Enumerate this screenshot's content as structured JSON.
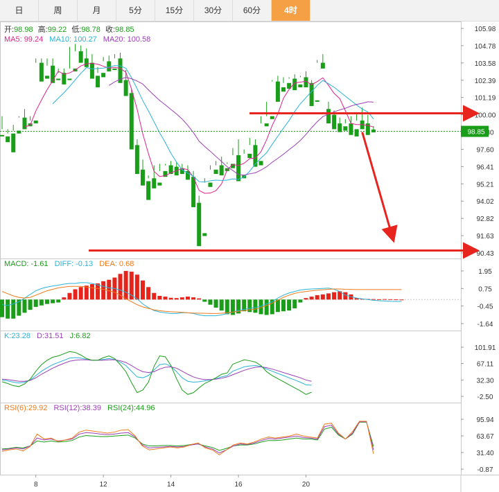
{
  "tabs": [
    {
      "label": "日",
      "active": false
    },
    {
      "label": "周",
      "active": false
    },
    {
      "label": "月",
      "active": false
    },
    {
      "label": "5分",
      "active": false
    },
    {
      "label": "15分",
      "active": false
    },
    {
      "label": "30分",
      "active": false
    },
    {
      "label": "60分",
      "active": false
    },
    {
      "label": "4时",
      "active": true
    }
  ],
  "info": {
    "open_label": "开:",
    "open": "98.98",
    "high_label": "高:",
    "high": "99.22",
    "low_label": "低:",
    "low": "98.78",
    "close_label": "收:",
    "close": "98.85",
    "ma5_label": "MA5:",
    "ma5": "99.24",
    "ma10_label": "MA10:",
    "ma10": "100.27",
    "ma20_label": "MA20:",
    "ma20": "100.58"
  },
  "macd_legend": {
    "macd_label": "MACD:",
    "macd": "-1.61",
    "diff_label": "DIFF:",
    "diff": "-0.13",
    "dea_label": "DEA:",
    "dea": "0.68"
  },
  "kdj_legend": {
    "k_label": "K:",
    "k": "23.28",
    "d_label": "D:",
    "d": "31.51",
    "j_label": "J:",
    "j": "6.82"
  },
  "rsi_legend": {
    "r6_label": "RSI(6):",
    "r6": "29.92",
    "r12_label": "RSI(12):",
    "r12": "38.39",
    "r24_label": "RSI(24):",
    "r24": "44.96"
  },
  "colors": {
    "up": "#e5251c",
    "down": "#1a9e1a",
    "ma5": "#e0208c",
    "ma10": "#2ab3d6",
    "ma20": "#9b3fb5",
    "arrow": "#e8241f",
    "current": "#1a9e1a",
    "macd_label": "#1a9e1a",
    "dea": "#f07a1a",
    "k": "#2ab3d6",
    "d": "#9b3fb5",
    "j": "#1a9e1a",
    "rsi6": "#f07a1a",
    "rsi12": "#9b3fb5",
    "rsi24": "#1a9e1a"
  },
  "current_price_label": "98.85",
  "chart_data": {
    "type": "candlestick",
    "x_tick_labels": [
      {
        "label": "8",
        "index": 6
      },
      {
        "label": "12",
        "index": 18
      },
      {
        "label": "14",
        "index": 30
      },
      {
        "label": "16",
        "index": 42
      },
      {
        "label": "20",
        "index": 54
      }
    ],
    "y_ticks": [
      "105.98",
      "104.78",
      "103.58",
      "102.39",
      "101.19",
      "100.00",
      "98.80",
      "97.60",
      "96.41",
      "95.21",
      "94.02",
      "92.82",
      "91.63",
      "90.43"
    ],
    "ylim": [
      90.43,
      105.98
    ],
    "candles": [
      [
        98.6,
        99.9,
        99.0,
        98.5
      ],
      [
        98.5,
        99.0,
        98.7,
        98.1
      ],
      [
        98.7,
        99.3,
        98.9,
        97.4
      ],
      [
        98.9,
        99.9,
        99.8,
        98.7
      ],
      [
        99.8,
        100.4,
        99.4,
        99.0
      ],
      [
        99.4,
        99.9,
        99.6,
        99.2
      ],
      [
        99.6,
        103.9,
        103.6,
        99.4
      ],
      [
        103.6,
        103.9,
        102.7,
        102.3
      ],
      [
        102.7,
        103.9,
        103.4,
        102.5
      ],
      [
        103.4,
        103.9,
        102.5,
        102.2
      ],
      [
        102.5,
        103.2,
        102.9,
        102.4
      ],
      [
        102.9,
        103.2,
        102.5,
        102.1
      ],
      [
        102.5,
        104.7,
        103.2,
        102.4
      ],
      [
        103.2,
        104.9,
        104.4,
        103.0
      ],
      [
        104.4,
        104.8,
        103.9,
        103.6
      ],
      [
        103.9,
        104.6,
        103.6,
        103.3
      ],
      [
        103.6,
        104.2,
        102.7,
        102.5
      ],
      [
        102.7,
        103.3,
        102.9,
        101.9
      ],
      [
        102.9,
        104.0,
        103.7,
        102.6
      ],
      [
        103.7,
        104.1,
        103.2,
        103.0
      ],
      [
        103.2,
        104.2,
        103.9,
        103.1
      ],
      [
        103.9,
        104.3,
        102.4,
        102.2
      ],
      [
        102.4,
        103.1,
        101.5,
        101.3
      ],
      [
        101.5,
        101.8,
        97.9,
        97.6
      ],
      [
        97.9,
        98.3,
        96.2,
        95.9
      ],
      [
        96.2,
        96.9,
        95.4,
        95.1
      ],
      [
        95.4,
        95.8,
        95.6,
        94.1
      ],
      [
        95.6,
        96.5,
        95.3,
        94.9
      ],
      [
        95.3,
        96.6,
        96.1,
        95.1
      ],
      [
        96.1,
        96.6,
        96.5,
        95.7
      ],
      [
        96.5,
        96.8,
        96.4,
        95.9
      ],
      [
        96.4,
        96.7,
        96.3,
        95.8
      ],
      [
        96.3,
        96.6,
        96.1,
        95.9
      ],
      [
        96.1,
        96.5,
        95.7,
        95.5
      ],
      [
        95.7,
        96.1,
        93.9,
        93.6
      ],
      [
        93.9,
        94.4,
        91.8,
        90.9
      ],
      [
        91.8,
        95.6,
        95.3,
        91.6
      ],
      [
        95.3,
        96.5,
        96.2,
        95.0
      ],
      [
        96.2,
        96.8,
        96.5,
        95.9
      ],
      [
        96.5,
        97.1,
        96.3,
        95.8
      ],
      [
        96.3,
        96.7,
        96.6,
        96.1
      ],
      [
        96.6,
        97.7,
        97.2,
        96.3
      ],
      [
        97.2,
        98.3,
        95.8,
        95.4
      ],
      [
        95.8,
        97.6,
        97.3,
        95.6
      ],
      [
        97.3,
        98.4,
        97.9,
        97.0
      ],
      [
        97.9,
        98.3,
        96.8,
        96.4
      ],
      [
        96.8,
        99.9,
        99.4,
        96.5
      ],
      [
        99.4,
        100.9,
        99.9,
        99.2
      ],
      [
        99.9,
        102.4,
        102.3,
        99.7
      ],
      [
        102.3,
        102.7,
        101.9,
        100.9
      ],
      [
        101.9,
        102.6,
        102.2,
        101.6
      ],
      [
        102.2,
        102.6,
        102.5,
        101.8
      ],
      [
        102.5,
        102.8,
        102.1,
        101.7
      ],
      [
        102.1,
        102.7,
        102.6,
        101.9
      ],
      [
        102.6,
        103.0,
        102.2,
        101.9
      ],
      [
        102.2,
        102.4,
        101.0,
        100.6
      ],
      [
        101.0,
        103.8,
        103.6,
        100.9
      ],
      [
        103.6,
        104.2,
        103.4,
        103.2
      ],
      [
        100.4,
        100.9,
        100.0,
        99.4
      ],
      [
        100.0,
        100.3,
        99.4,
        99.0
      ],
      [
        99.4,
        99.8,
        99.2,
        98.8
      ],
      [
        99.2,
        99.7,
        99.4,
        98.9
      ],
      [
        99.4,
        99.9,
        99.0,
        98.6
      ],
      [
        99.0,
        100.1,
        99.6,
        98.5
      ],
      [
        99.6,
        100.5,
        99.4,
        99.0
      ],
      [
        99.4,
        100.0,
        98.9,
        98.6
      ],
      [
        98.98,
        99.22,
        98.85,
        98.78
      ]
    ],
    "annotations": {
      "resistance_price": 100.1,
      "support_price": 90.6,
      "projection_arrow": {
        "from": [
          64,
          98.8
        ],
        "to": [
          75,
          91.4
        ]
      }
    },
    "macd": {
      "ylim": [
        -1.64,
        1.95
      ],
      "ticks": [
        "1.95",
        "0.75",
        "-0.45",
        "-1.64"
      ],
      "hist": [
        -1.2,
        -1.3,
        -1.3,
        -1.1,
        -0.9,
        -0.7,
        -0.5,
        -0.4,
        -0.3,
        -0.25,
        -0.2,
        0.15,
        0.45,
        0.7,
        0.85,
        0.95,
        1.05,
        1.1,
        1.25,
        1.35,
        1.5,
        1.75,
        1.95,
        1.9,
        1.7,
        1.3,
        0.85,
        0.45,
        0.25,
        0.2,
        0.12,
        0.1,
        0.15,
        0.2,
        0.15,
        0.08,
        -0.15,
        -0.35,
        -0.55,
        -0.75,
        -1.0,
        -1.05,
        -0.95,
        -0.8,
        -0.85,
        -0.9,
        -1.0,
        -1.05,
        -1.0,
        -0.85,
        -0.8,
        -0.75,
        -0.6,
        -0.2,
        0.1,
        0.2,
        0.3,
        0.35,
        0.42,
        0.5,
        0.56,
        0.5,
        0.35,
        0.1,
        0.05,
        0.04,
        0.03,
        0.02,
        0.03,
        0.02,
        0.01,
        0.0
      ],
      "diff": [
        -0.35,
        -0.4,
        -0.3,
        -0.15,
        0.1,
        0.35,
        0.6,
        0.75,
        0.85,
        0.92,
        0.98,
        1.05,
        1.1,
        1.1,
        1.15,
        1.15,
        1.1,
        1.0,
        0.9,
        0.8,
        0.75,
        0.65,
        0.5,
        0.3,
        0.05,
        -0.3,
        -0.55,
        -0.75,
        -0.85,
        -0.9,
        -0.95,
        -0.95,
        -0.9,
        -0.9,
        -0.95,
        -1.05,
        -1.1,
        -1.1,
        -1.1,
        -1.05,
        -0.95,
        -0.85,
        -0.75,
        -0.68,
        -0.6,
        -0.55,
        -0.45,
        -0.3,
        -0.15,
        0.1,
        0.3,
        0.45,
        0.55,
        0.65,
        0.7,
        0.72,
        0.74,
        0.76,
        0.78,
        0.7,
        0.55,
        0.3,
        0.2,
        0.1,
        0.05,
        0.0,
        -0.05,
        -0.08,
        -0.1,
        -0.12,
        -0.13,
        -0.13
      ],
      "dea": [
        0.55,
        0.4,
        0.25,
        0.15,
        0.1,
        0.15,
        0.3,
        0.45,
        0.6,
        0.7,
        0.8,
        0.85,
        0.9,
        0.9,
        0.9,
        0.85,
        0.8,
        0.75,
        0.7,
        0.6,
        0.5,
        0.3,
        0.05,
        -0.15,
        -0.35,
        -0.5,
        -0.6,
        -0.7,
        -0.76,
        -0.8,
        -0.83,
        -0.85,
        -0.87,
        -0.9,
        -0.92,
        -0.93,
        -0.94,
        -0.95,
        -0.95,
        -0.93,
        -0.9,
        -0.85,
        -0.8,
        -0.75,
        -0.7,
        -0.65,
        -0.55,
        -0.4,
        -0.25,
        -0.05,
        0.15,
        0.3,
        0.42,
        0.5,
        0.55,
        0.6,
        0.64,
        0.67,
        0.7,
        0.72,
        0.72,
        0.7,
        0.69,
        0.68,
        0.68,
        0.68,
        0.68,
        0.68,
        0.68,
        0.68,
        0.68,
        0.68
      ]
    },
    "kdj": {
      "ylim": [
        -2.5,
        110
      ],
      "ticks": [
        "101.91",
        "67.11",
        "32.30",
        "-2.50"
      ],
      "k": [
        35,
        33,
        30,
        28,
        30,
        35,
        45,
        55,
        63,
        70,
        75,
        80,
        85,
        86,
        85,
        82,
        80,
        80,
        82,
        84,
        82,
        76,
        68,
        55,
        42,
        40,
        45,
        58,
        70,
        72,
        66,
        54,
        40,
        32,
        30,
        31,
        33,
        35,
        38,
        42,
        45,
        55,
        60,
        65,
        67,
        68,
        66,
        60,
        55,
        50,
        45,
        40,
        35,
        30,
        24,
        23
      ],
      "d": [
        37,
        36,
        34,
        32,
        32,
        34,
        40,
        48,
        55,
        62,
        68,
        73,
        78,
        80,
        81,
        81,
        80,
        80,
        80,
        81,
        81,
        79,
        75,
        68,
        60,
        54,
        52,
        54,
        60,
        64,
        65,
        62,
        55,
        48,
        42,
        38,
        36,
        36,
        37,
        39,
        42,
        47,
        52,
        57,
        61,
        64,
        65,
        63,
        60,
        56,
        52,
        48,
        44,
        40,
        35,
        32
      ],
      "j": [
        31,
        27,
        22,
        20,
        26,
        37,
        55,
        70,
        80,
        87,
        90,
        95,
        100,
        98,
        92,
        84,
        80,
        80,
        86,
        90,
        84,
        70,
        54,
        29,
        6,
        12,
        30,
        66,
        90,
        88,
        68,
        38,
        12,
        2,
        6,
        17,
        27,
        33,
        40,
        48,
        51,
        71,
        76,
        81,
        79,
        76,
        68,
        54,
        45,
        38,
        31,
        24,
        17,
        10,
        2,
        7
      ]
    },
    "rsi": {
      "ylim": [
        -0.87,
        100
      ],
      "ticks": [
        "95.94",
        "63.67",
        "31.40",
        "-0.87"
      ],
      "r6": [
        35,
        38,
        40,
        36,
        45,
        70,
        60,
        62,
        55,
        58,
        62,
        74,
        78,
        76,
        74,
        72,
        74,
        78,
        79,
        66,
        46,
        38,
        40,
        42,
        44,
        42,
        44,
        49,
        52,
        42,
        38,
        28,
        38,
        48,
        52,
        50,
        54,
        60,
        64,
        62,
        64,
        66,
        70,
        66,
        64,
        62,
        90,
        92,
        72,
        60,
        75,
        96,
        96,
        30
      ],
      "r12": [
        38,
        40,
        42,
        40,
        46,
        62,
        58,
        60,
        56,
        58,
        60,
        70,
        73,
        72,
        70,
        69,
        70,
        72,
        73,
        64,
        48,
        42,
        43,
        44,
        45,
        44,
        45,
        48,
        50,
        44,
        40,
        32,
        38,
        46,
        50,
        49,
        52,
        57,
        61,
        60,
        62,
        64,
        66,
        63,
        62,
        60,
        85,
        88,
        70,
        60,
        72,
        95,
        95,
        38
      ],
      "r24": [
        40,
        41,
        43,
        42,
        46,
        56,
        54,
        56,
        54,
        55,
        57,
        64,
        67,
        66,
        65,
        65,
        66,
        67,
        68,
        62,
        50,
        46,
        46,
        47,
        47,
        46,
        47,
        49,
        50,
        46,
        43,
        37,
        41,
        46,
        48,
        48,
        50,
        54,
        57,
        57,
        58,
        60,
        62,
        60,
        60,
        58,
        80,
        84,
        68,
        60,
        70,
        94,
        94,
        45
      ]
    }
  }
}
